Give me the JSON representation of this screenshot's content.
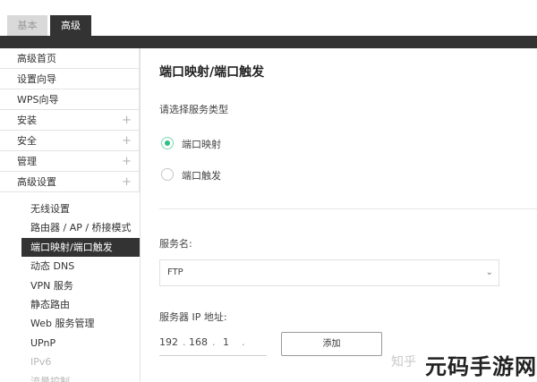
{
  "tabs": {
    "basic": "基本",
    "advanced": "高级"
  },
  "sidebar": {
    "items": [
      {
        "label": "高级首页",
        "expandable": false
      },
      {
        "label": "设置向导",
        "expandable": false
      },
      {
        "label": "WPS向导",
        "expandable": false
      },
      {
        "label": "安装",
        "expandable": true
      },
      {
        "label": "安全",
        "expandable": true
      },
      {
        "label": "管理",
        "expandable": true
      },
      {
        "label": "高级设置",
        "expandable": true
      }
    ],
    "plus_symbol": "+",
    "subitems": [
      {
        "label": "无线设置",
        "state": "normal"
      },
      {
        "label": "路由器 / AP / 桥接模式",
        "state": "normal"
      },
      {
        "label": "端口映射/端口触发",
        "state": "active"
      },
      {
        "label": "动态 DNS",
        "state": "normal"
      },
      {
        "label": "VPN 服务",
        "state": "normal"
      },
      {
        "label": "静态路由",
        "state": "normal"
      },
      {
        "label": "Web 服务管理",
        "state": "normal"
      },
      {
        "label": "UPnP",
        "state": "normal"
      },
      {
        "label": "IPv6",
        "state": "dim"
      },
      {
        "label": "流量控制",
        "state": "dim"
      }
    ]
  },
  "main": {
    "title": "端口映射/端口触发",
    "service_type_label": "请选择服务类型",
    "options": [
      {
        "label": "端口映射",
        "selected": true
      },
      {
        "label": "端口触发",
        "selected": false
      }
    ],
    "service_name_label": "服务名:",
    "service_name_value": "FTP",
    "server_ip_label": "服务器 IP 地址:",
    "ip_segments": [
      "192",
      "168",
      "1",
      ""
    ],
    "ip_separator": ".",
    "add_button": "添加"
  },
  "watermark": {
    "zhihu": "知乎",
    "brand": "元码手游网"
  },
  "colors": {
    "dark": "#333333",
    "radio_selected": "#2fbf85"
  }
}
